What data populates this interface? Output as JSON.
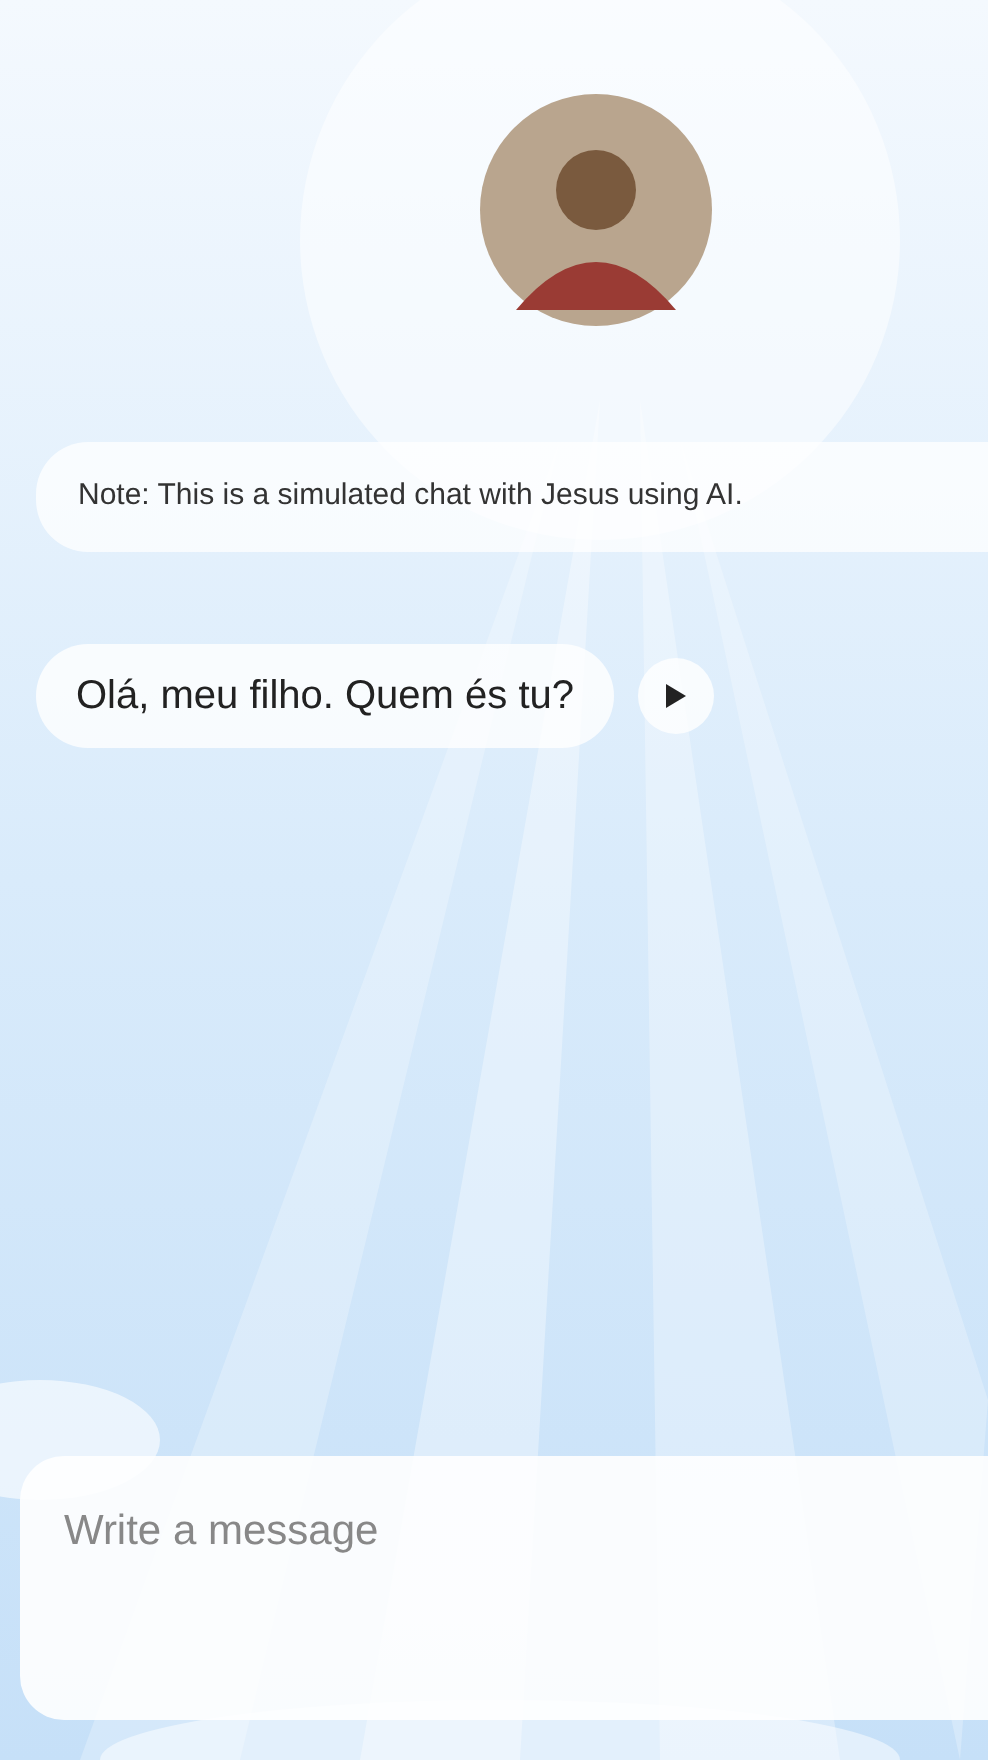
{
  "note": "Note: This is a simulated chat with Jesus using AI.",
  "messages": [
    {
      "kind": "assistant",
      "text": "Olá, meu filho. Quem és tu?"
    }
  ],
  "composer": {
    "placeholder": "Write a message"
  }
}
